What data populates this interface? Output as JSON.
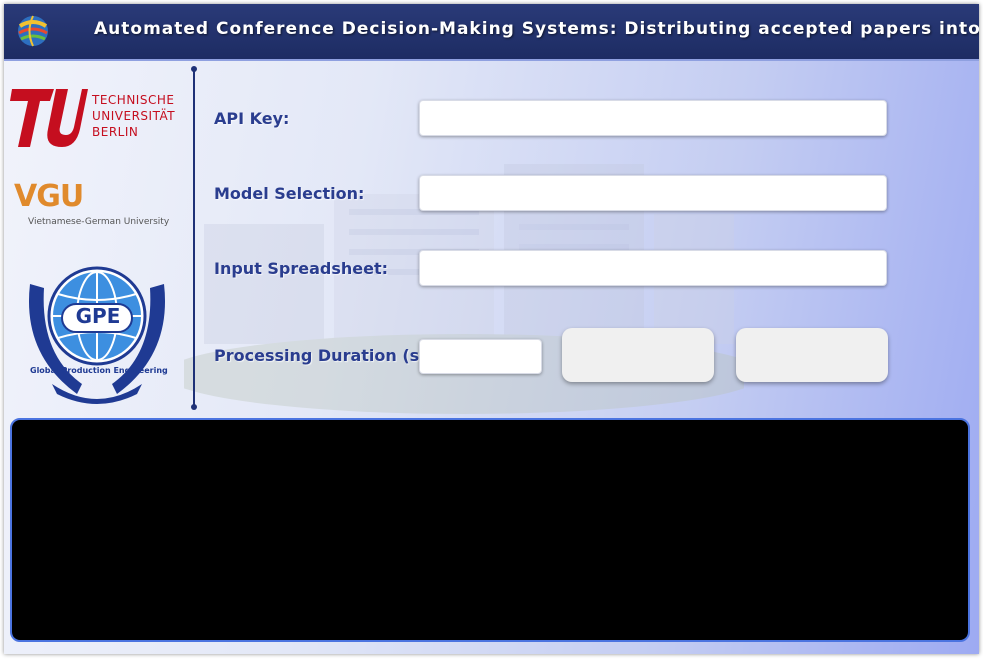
{
  "header": {
    "title": "Automated Conference Decision-Making Systems: Distributing accepted papers into sessions",
    "logo_icon": "globe-logo-icon"
  },
  "logos": {
    "tu_berlin": {
      "line1": "TECHNISCHE",
      "line2": "UNIVERSITÄT",
      "line3": "BERLIN",
      "color": "#c50e1f"
    },
    "vgu": {
      "mark": "VGU",
      "subtitle": "Vietnamese-German University",
      "color": "#e08a2c"
    },
    "gpe": {
      "mark": "GPE",
      "ring_text": "Global Production Engineering",
      "color": "#1f3a93"
    }
  },
  "form": {
    "api_key": {
      "label": "API Key:",
      "value": "",
      "placeholder": ""
    },
    "model_selection": {
      "label": "Model Selection:",
      "value": "",
      "placeholder": ""
    },
    "input_spreadsheet": {
      "label": "Input Spreadsheet:",
      "value": "",
      "placeholder": ""
    },
    "processing_duration": {
      "label": "Processing Duration (s)",
      "value": "",
      "placeholder": ""
    }
  },
  "buttons": {
    "left_label": "",
    "right_label": ""
  },
  "output": {
    "text": ""
  },
  "colors": {
    "title_bar": "#1d2c63",
    "label_text": "#2a3d8f",
    "console_border": "#4b74e0",
    "console_bg": "#000000"
  }
}
